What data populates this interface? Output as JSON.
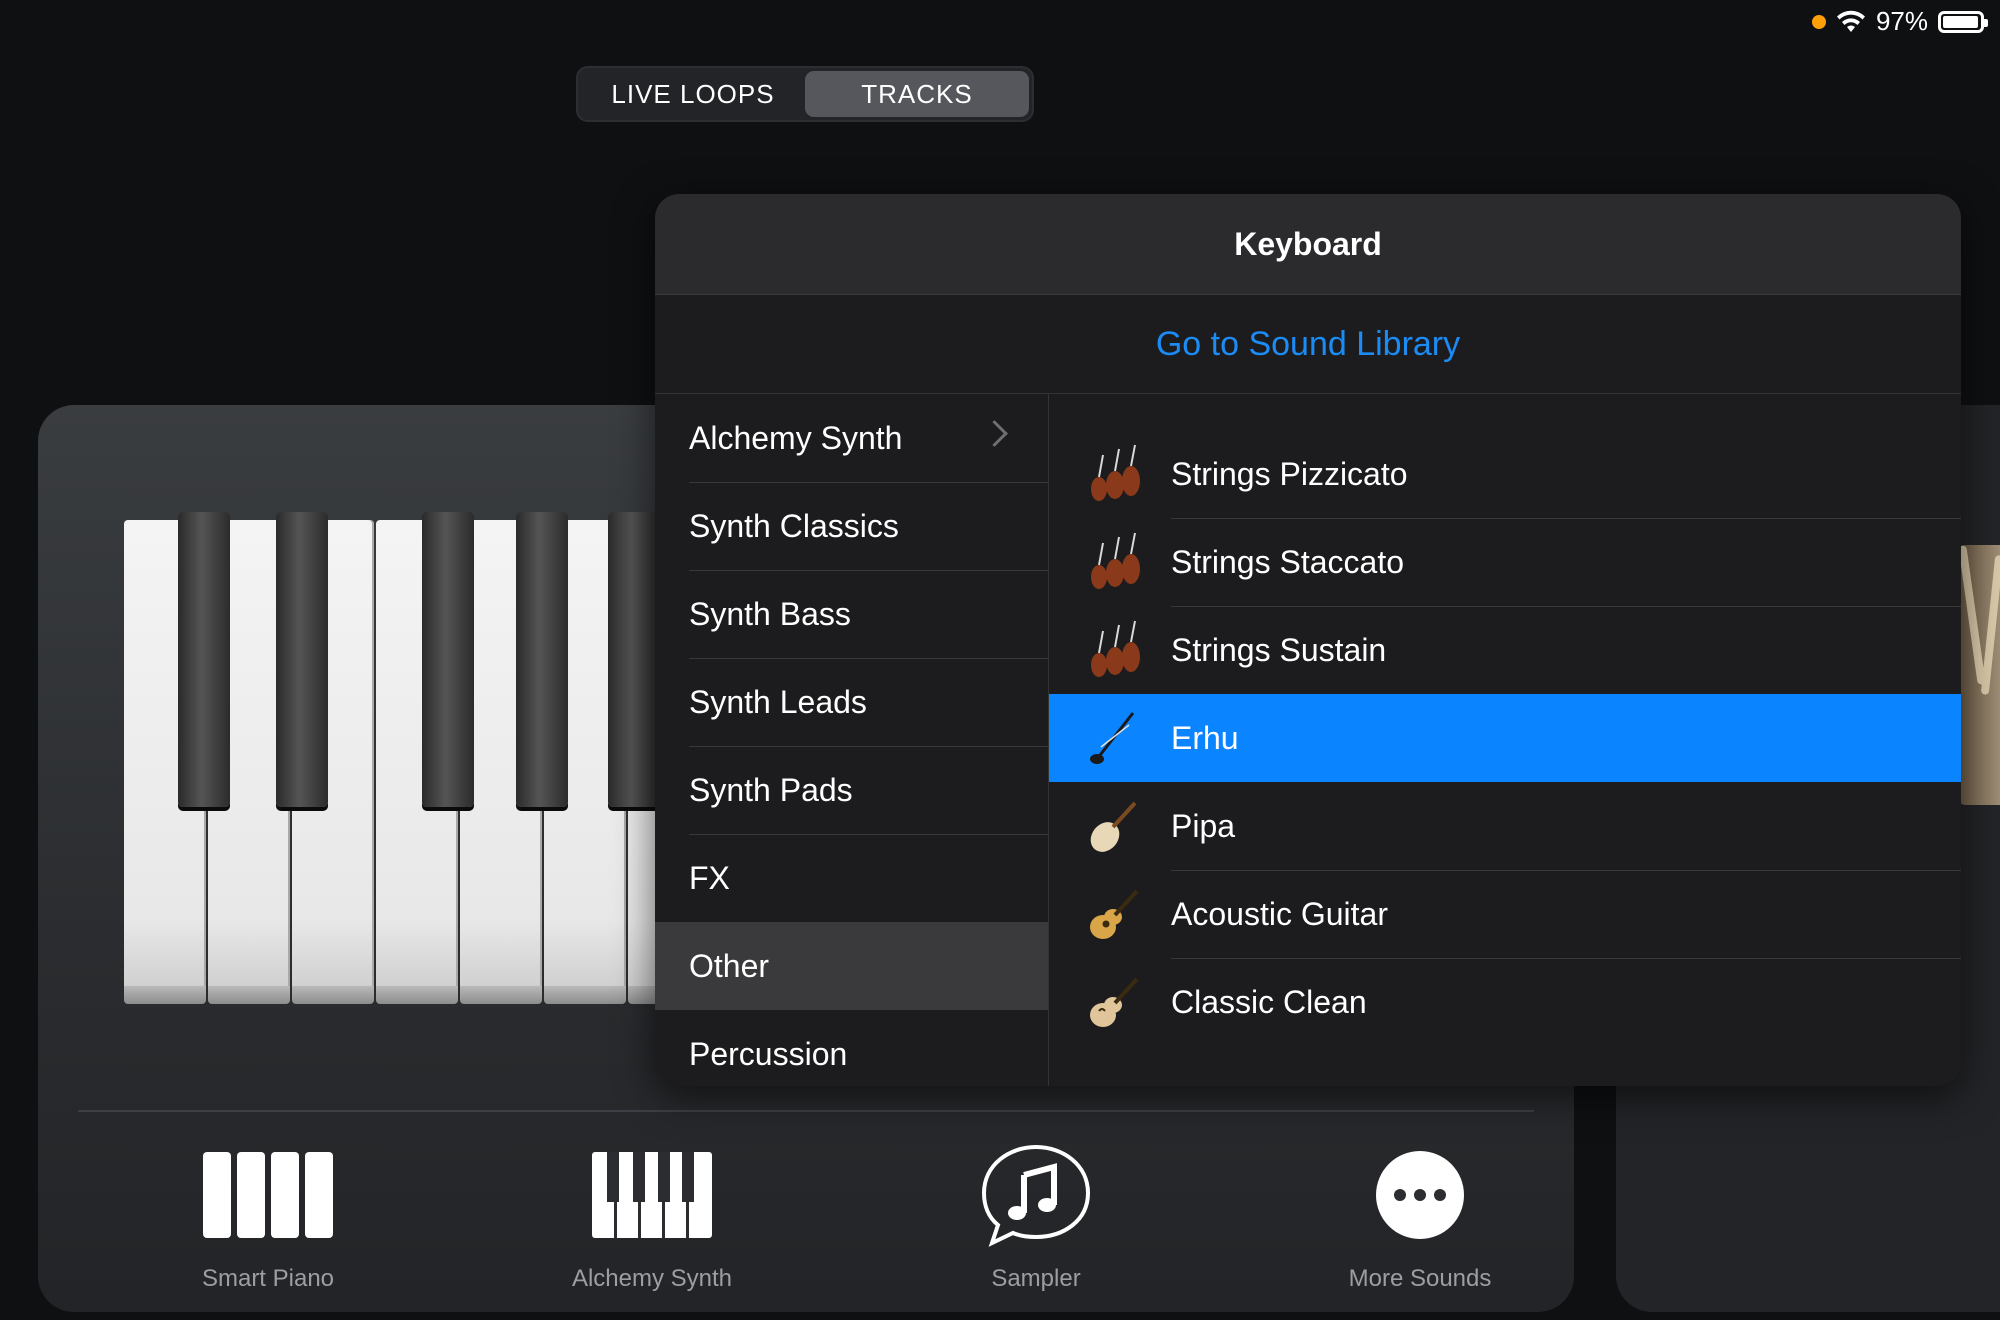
{
  "status_bar": {
    "battery_text": "97%",
    "battery_level": 0.97,
    "recording_dot_color": "#ff9f0a"
  },
  "segmented": {
    "live_loops": "LIVE LOOPS",
    "tracks": "TRACKS",
    "selected": "TRACKS"
  },
  "popover": {
    "title": "Keyboard",
    "link": "Go to Sound Library",
    "categories": [
      {
        "label": "Alchemy Synth",
        "has_chevron": true
      },
      {
        "label": "Synth Classics"
      },
      {
        "label": "Synth Bass"
      },
      {
        "label": "Synth Leads"
      },
      {
        "label": "Synth Pads"
      },
      {
        "label": "FX"
      },
      {
        "label": "Other",
        "selected": true
      },
      {
        "label": "Percussion"
      }
    ],
    "sounds": [
      {
        "label": "Strings Pizzicato",
        "icon": "violin-icon"
      },
      {
        "label": "Strings Staccato",
        "icon": "violin-icon"
      },
      {
        "label": "Strings Sustain",
        "icon": "violin-icon"
      },
      {
        "label": "Erhu",
        "icon": "erhu-icon",
        "selected": true
      },
      {
        "label": "Pipa",
        "icon": "pipa-icon"
      },
      {
        "label": "Acoustic Guitar",
        "icon": "acoustic-guitar-icon"
      },
      {
        "label": "Classic Clean",
        "icon": "electric-guitar-icon"
      }
    ],
    "accent_color": "#0a84ff"
  },
  "instruments": [
    {
      "label": "Smart Piano",
      "icon": "smart-piano-icon"
    },
    {
      "label": "Alchemy Synth",
      "icon": "synth-keys-icon"
    },
    {
      "label": "Sampler",
      "icon": "sampler-icon"
    },
    {
      "label": "More Sounds",
      "icon": "more-icon"
    }
  ]
}
